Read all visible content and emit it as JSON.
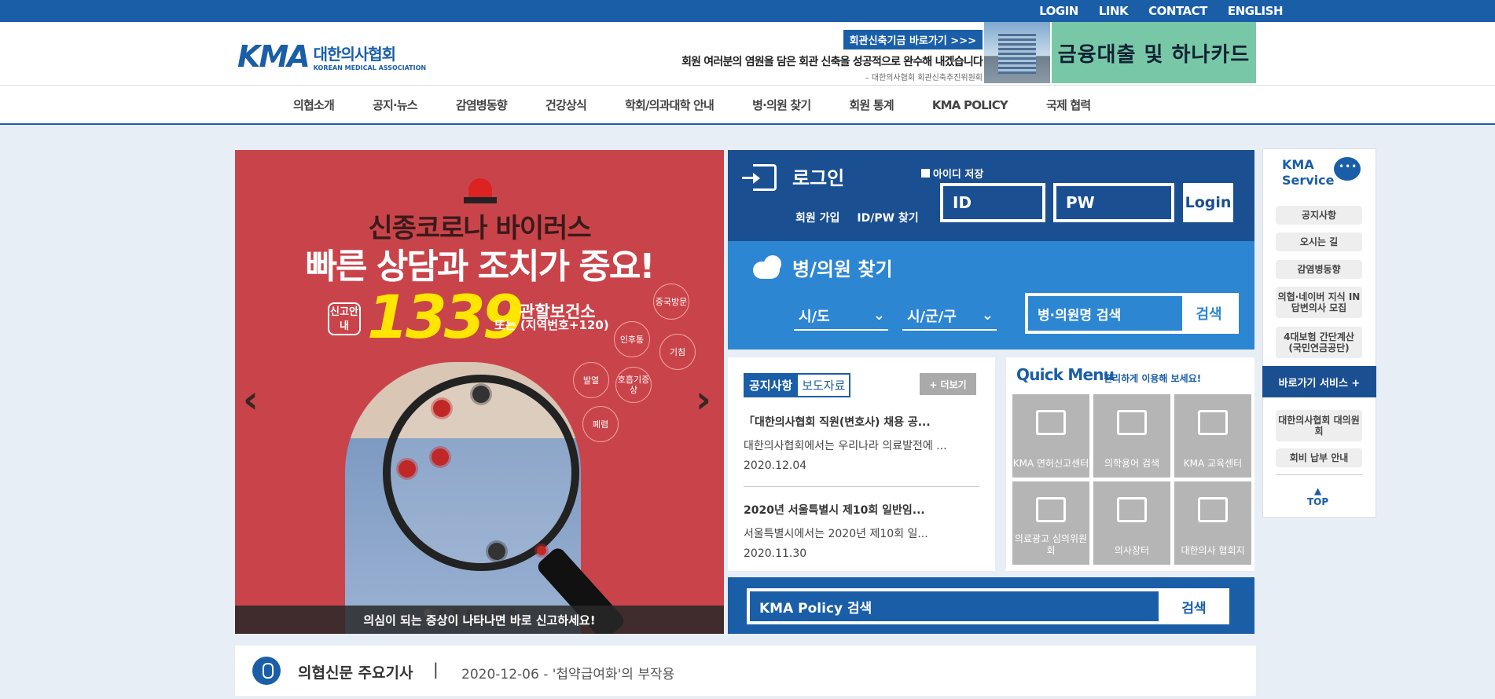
{
  "topbar": {
    "links": [
      "LOGIN",
      "LINK",
      "CONTACT",
      "ENGLISH"
    ]
  },
  "logo": {
    "mark": "KMA",
    "korean": "대한의사협회",
    "english": "KOREAN MEDICAL ASSOCIATION"
  },
  "banner": {
    "button": "회관신축기금 바로가기 >>>",
    "line": "회원 여러분의 염원을 담은 회관 신축을 성공적으로 완수해 내겠습니다",
    "small": "– 대한의사협회 회관신축추진위원회",
    "hana": "금융대출 및 하나카드"
  },
  "nav": [
    "의협소개",
    "공지·뉴스",
    "감염병동향",
    "건강상식",
    "학회/의과대학 안내",
    "병·의원 찾기",
    "회원 통계",
    "KMA POLICY",
    "국제 협력"
  ],
  "slide": {
    "h1": "신종코로나 바이러스",
    "h2": "빠른 상담과 조치가 중요!",
    "report": "신고안내",
    "number": "1339",
    "center": "관할보건소",
    "or": "또는 (지역번호+120)",
    "symptoms": [
      "중국방문",
      "인후통",
      "기침",
      "발열",
      "호흡기증상",
      "폐렴"
    ],
    "caption": "의심이 되는 증상이 나타나면 바로 신고하세요!",
    "prev": "‹",
    "next": "›"
  },
  "login": {
    "title": "로그인",
    "save_id": "아이디 저장",
    "join": "회원 가입",
    "find": "ID/PW 찾기",
    "id_placeholder": "ID",
    "pw_placeholder": "PW",
    "button": "Login"
  },
  "hospital": {
    "title": "병/의원 찾기",
    "sido": "시/도",
    "sigungu": "시/군/구",
    "search_placeholder": "병·의원명 검색",
    "search_button": "검색"
  },
  "notice": {
    "tab_active": "공지사항",
    "tab_other": "보도자료",
    "more": "+ 더보기",
    "items": [
      {
        "title": "「대한의사협회 직원(변호사) 채용 공...",
        "desc": "대한의사협회에서는 우리나라 의료발전에 ...",
        "date": "2020.12.04"
      },
      {
        "title": "2020년 서울특별시 제10회 일반임...",
        "desc": "서울특별시에서는 2020년 제10회 일...",
        "date": "2020.11.30"
      }
    ]
  },
  "quick": {
    "title": "Quick Menu",
    "subtitle": "편리하게 이용해 보세요!",
    "items": [
      "KMA 면허신고센터",
      "의학용어 검색",
      "KMA 교육센터",
      "의료광고 심의위원회",
      "의사장터",
      "대한의사 협회지"
    ]
  },
  "policy": {
    "placeholder": "KMA Policy 검색",
    "button": "검색"
  },
  "news": {
    "label": "의협신문 주요기사",
    "separator": "|",
    "headline": "2020-12-06 - '첩약급여화'의 부작용"
  },
  "side": {
    "title1": "KMA",
    "title2": "Service",
    "buttons": [
      "공지사항",
      "오시는 길",
      "감염병동향",
      "의협·네이버 지식 IN 답변의사 모집",
      "4대보험 간단계산 (국민연금공단)"
    ],
    "shortcut": "바로가기 서비스 +",
    "buttons2": [
      "대한의사협회 대의원회",
      "회비 납부 안내"
    ],
    "top": "TOP"
  },
  "colors": {
    "primary": "#1a5ea8",
    "login_bg": "#1a4f92",
    "hospital_bg": "#2c86d2",
    "slide_bg": "#c9444a",
    "hana": "#78c8a8"
  }
}
